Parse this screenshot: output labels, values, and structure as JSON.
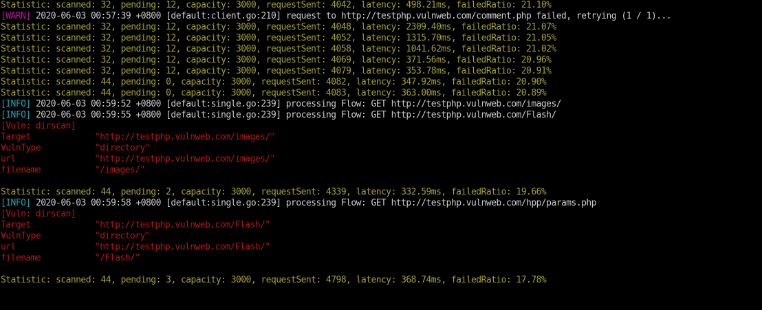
{
  "colors": {
    "background": "#000000",
    "statistic": "#a3a133",
    "warn": "#b4179e",
    "info": "#2aa1b3",
    "plain": "#cccccc",
    "vuln": "#b5171a"
  },
  "lines": [
    {
      "type": "stat",
      "text": "Statistic: scanned: 32, pending: 12, capacity: 3000, requestSent: 4042, latency: 498.21ms, failedRatio: 21.10%"
    },
    {
      "type": "warn",
      "tag": "[WARN]",
      "text": " 2020-06-03 00:57:39 +0800 [default:client.go:210] request to http://testphp.vulnweb.com/comment.php failed, retrying (1 / 1)..."
    },
    {
      "type": "stat",
      "text": "Statistic: scanned: 32, pending: 12, capacity: 3000, requestSent: 4048, latency: 2309.40ms, failedRatio: 21.07%"
    },
    {
      "type": "stat",
      "text": "Statistic: scanned: 32, pending: 12, capacity: 3000, requestSent: 4052, latency: 1315.70ms, failedRatio: 21.05%"
    },
    {
      "type": "stat",
      "text": "Statistic: scanned: 32, pending: 12, capacity: 3000, requestSent: 4058, latency: 1041.62ms, failedRatio: 21.02%"
    },
    {
      "type": "stat",
      "text": "Statistic: scanned: 32, pending: 12, capacity: 3000, requestSent: 4069, latency: 371.56ms, failedRatio: 20.96%"
    },
    {
      "type": "stat",
      "text": "Statistic: scanned: 32, pending: 12, capacity: 3000, requestSent: 4079, latency: 353.78ms, failedRatio: 20.91%"
    },
    {
      "type": "stat",
      "text": "Statistic: scanned: 44, pending: 0, capacity: 3000, requestSent: 4082, latency: 347.92ms, failedRatio: 20.90%"
    },
    {
      "type": "stat",
      "text": "Statistic: scanned: 44, pending: 0, capacity: 3000, requestSent: 4083, latency: 363.00ms, failedRatio: 20.89%"
    },
    {
      "type": "info",
      "tag": "[INFO]",
      "text": " 2020-06-03 00:59:52 +0800 [default:single.go:239] processing Flow: GET http://testphp.vulnweb.com/images/"
    },
    {
      "type": "info",
      "tag": "[INFO]",
      "text": " 2020-06-03 00:59:55 +0800 [default:single.go:239] processing Flow: GET http://testphp.vulnweb.com/Flash/"
    },
    {
      "type": "vuln",
      "text": "[Vuln: dirscan]"
    },
    {
      "type": "kv",
      "key": "Target",
      "value": "\"http://testphp.vulnweb.com/images/\""
    },
    {
      "type": "kv",
      "key": "VulnType",
      "value": "\"directory\""
    },
    {
      "type": "kv",
      "key": "url",
      "value": "\"http://testphp.vulnweb.com/images/\""
    },
    {
      "type": "kv",
      "key": "filename",
      "value": "\"/images/\""
    },
    {
      "type": "blank",
      "text": ""
    },
    {
      "type": "stat",
      "text": "Statistic: scanned: 44, pending: 2, capacity: 3000, requestSent: 4339, latency: 332.59ms, failedRatio: 19.66%"
    },
    {
      "type": "info",
      "tag": "[INFO]",
      "text": " 2020-06-03 00:59:58 +0800 [default:single.go:239] processing Flow: GET http://testphp.vulnweb.com/hpp/params.php"
    },
    {
      "type": "vuln",
      "text": "[Vuln: dirscan]"
    },
    {
      "type": "kv",
      "key": "Target",
      "value": "\"http://testphp.vulnweb.com/Flash/\""
    },
    {
      "type": "kv",
      "key": "VulnType",
      "value": "\"directory\""
    },
    {
      "type": "kv",
      "key": "url",
      "value": "\"http://testphp.vulnweb.com/Flash/\""
    },
    {
      "type": "kv",
      "key": "filename",
      "value": "\"/Flash/\""
    },
    {
      "type": "blank",
      "text": ""
    },
    {
      "type": "stat",
      "text": "Statistic: scanned: 44, pending: 3, capacity: 3000, requestSent: 4798, latency: 368.74ms, failedRatio: 17.78%"
    }
  ]
}
